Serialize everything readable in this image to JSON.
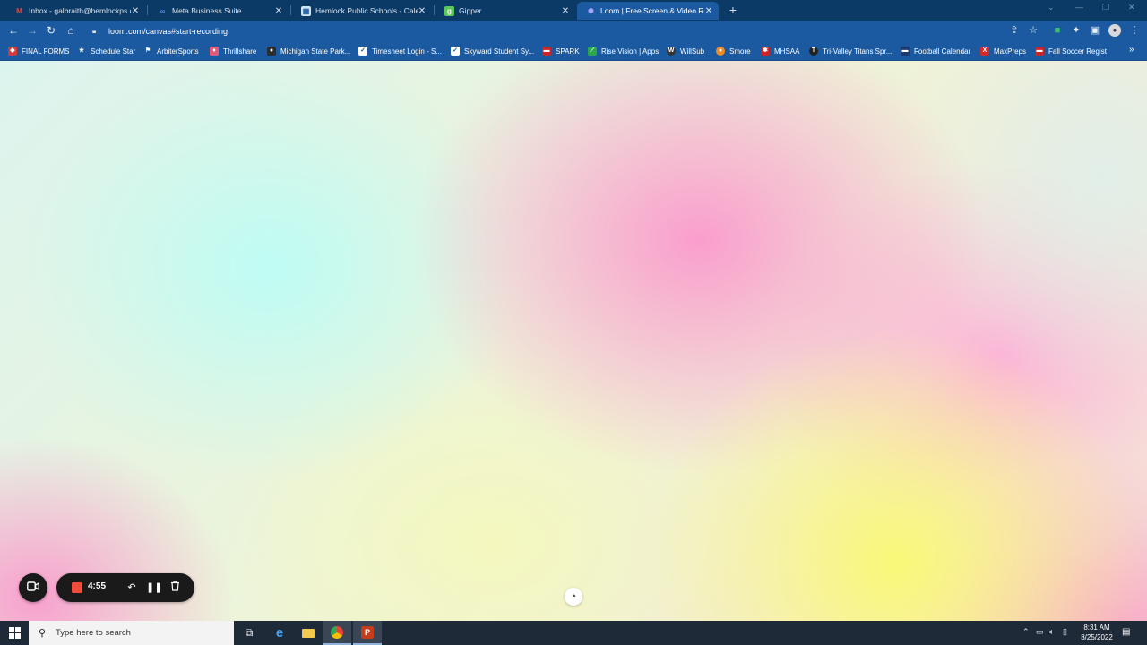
{
  "browser": {
    "tabs": [
      {
        "title": "Inbox - galbraith@hemlockps.com",
        "icon": "gmail-icon",
        "color": "#ea4335"
      },
      {
        "title": "Meta Business Suite",
        "icon": "meta-icon",
        "color": "#4a8cff"
      },
      {
        "title": "Hemlock Public Schools - Calendar",
        "icon": "calendar-icon",
        "color": "#cfe3f5"
      },
      {
        "title": "Gipper",
        "icon": "gipper-icon",
        "color": "#5cc85a"
      },
      {
        "title": "Loom | Free Screen & Video Recording",
        "icon": "loom-icon",
        "color": "#625df5",
        "active": true
      }
    ],
    "url": "loom.com/canvas#start-recording",
    "bookmarks": [
      {
        "label": "FINAL FORMS",
        "color": "#d43a3a"
      },
      {
        "label": "Schedule Star",
        "color": "#1b5aa0"
      },
      {
        "label": "ArbiterSports",
        "color": "#1b5aa0"
      },
      {
        "label": "Thrillshare",
        "color": "#e05a7a"
      },
      {
        "label": "Michigan State Park...",
        "color": "#2c2c2c"
      },
      {
        "label": "Timesheet Login - S...",
        "color": "#ffffff"
      },
      {
        "label": "Skyward Student Sy...",
        "color": "#ffffff"
      },
      {
        "label": "SPARK",
        "color": "#c8242a"
      },
      {
        "label": "Rise Vision | Apps",
        "color": "#2aa84a"
      },
      {
        "label": "WillSub",
        "color": "#333333"
      },
      {
        "label": "Smore",
        "color": "#f08a24"
      },
      {
        "label": "MHSAA",
        "color": "#c8242a"
      },
      {
        "label": "Tri-Valley Titans Spr...",
        "color": "#222222"
      },
      {
        "label": "Football Calendar",
        "color": "#1b3a70"
      },
      {
        "label": "MaxPreps",
        "color": "#d42a2a"
      },
      {
        "label": "Fall Soccer Regist",
        "color": "#c8242a"
      }
    ]
  },
  "recorder": {
    "timer": "4:55"
  },
  "taskbar": {
    "search_placeholder": "Type here to search",
    "time": "8:31 AM",
    "date": "8/25/2022"
  }
}
